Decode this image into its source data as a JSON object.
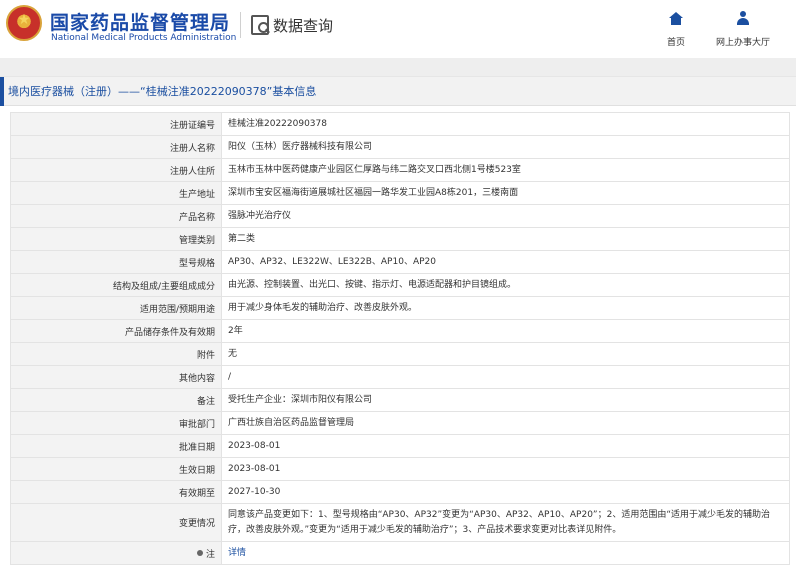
{
  "header": {
    "brand_cn": "国家药品监督管理局",
    "brand_en": "National Medical Products Administration",
    "query_label": "数据查询",
    "nav": {
      "home": "首页",
      "hall": "网上办事大厅"
    }
  },
  "title": "境内医疗器械（注册）——“桂械注准20222090378”基本信息",
  "rows": [
    {
      "label": "注册证编号",
      "value": "桂械注准20222090378"
    },
    {
      "label": "注册人名称",
      "value": "阳仪（玉林）医疗器械科技有限公司"
    },
    {
      "label": "注册人住所",
      "value": "玉林市玉林中医药健康产业园区仁厚路与纬二路交叉口西北侧1号楼523室"
    },
    {
      "label": "生产地址",
      "value": "深圳市宝安区福海街道展城社区福园一路华发工业园A8栋201，三楼南面"
    },
    {
      "label": "产品名称",
      "value": "强脉冲光治疗仪"
    },
    {
      "label": "管理类别",
      "value": "第二类"
    },
    {
      "label": "型号规格",
      "value": "AP30、AP32、LE322W、LE322B、AP10、AP20"
    },
    {
      "label": "结构及组成/主要组成成分",
      "value": "由光源、控制装置、出光口、按键、指示灯、电源适配器和护目镜组成。"
    },
    {
      "label": "适用范围/预期用途",
      "value": "用于减少身体毛发的辅助治疗、改善皮肤外观。"
    },
    {
      "label": "产品储存条件及有效期",
      "value": "2年"
    },
    {
      "label": "附件",
      "value": "无"
    },
    {
      "label": "其他内容",
      "value": "/"
    },
    {
      "label": "备注",
      "value": "受托生产企业：深圳市阳仪有限公司"
    },
    {
      "label": "审批部门",
      "value": "广西壮族自治区药品监督管理局"
    },
    {
      "label": "批准日期",
      "value": "2023-08-01"
    },
    {
      "label": "生效日期",
      "value": "2023-08-01"
    },
    {
      "label": "有效期至",
      "value": "2027-10-30"
    },
    {
      "label": "变更情况",
      "value": "同意该产品变更如下：1、型号规格由“AP30、AP32”变更为“AP30、AP32、AP10、AP20”；2、适用范围由“适用于减少毛发的辅助治疗，改善皮肤外观。”变更为“适用于减少毛发的辅助治疗”；3、产品技术要求变更对比表详见附件。"
    }
  ],
  "note": {
    "label": "注",
    "link": "详情"
  }
}
